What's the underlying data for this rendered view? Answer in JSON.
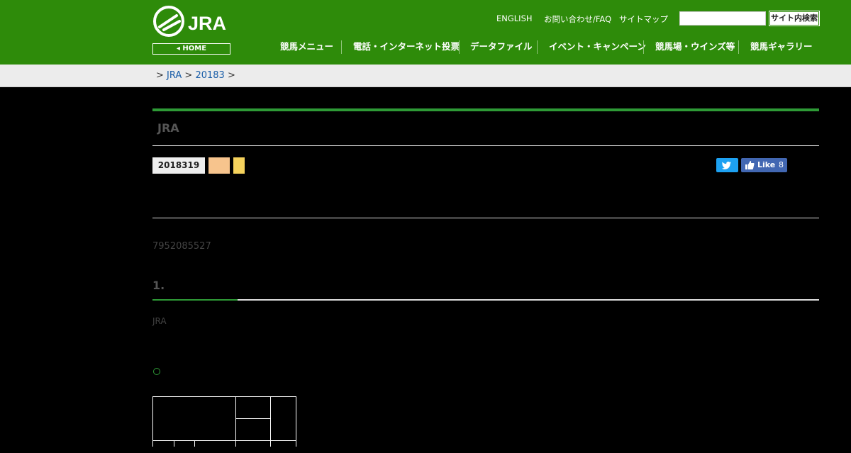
{
  "header": {
    "logo_text": "JRA",
    "home_label": "HOME",
    "top_links": [
      "ENGLISH",
      "お問い合わせ/FAQ",
      "サイトマップ"
    ],
    "search_placeholder": "",
    "search_button": "サイト内検索",
    "nav": [
      "競馬メニュー",
      "電話・インターネット投票",
      "データファイル",
      "イベント・キャンペーン",
      "競馬場・ウインズ等",
      "競馬ギャラリー"
    ]
  },
  "breadcrumb": {
    "sep": ">",
    "items": [
      "JRA",
      "20183"
    ]
  },
  "article": {
    "title": "JRA",
    "date": "2018319",
    "social": {
      "like_label": "Like",
      "like_count": "8"
    },
    "reference": "7952085527",
    "section_number": "1.",
    "body": "JRA",
    "list_marker": "○"
  },
  "colors": {
    "header_green": "#2e8b0a",
    "accent_green": "#2e9a36",
    "tag_orange": "#f7c48d",
    "tag_yellow": "#f5d25c",
    "twitter": "#1da1f2",
    "facebook": "#4267b2"
  }
}
